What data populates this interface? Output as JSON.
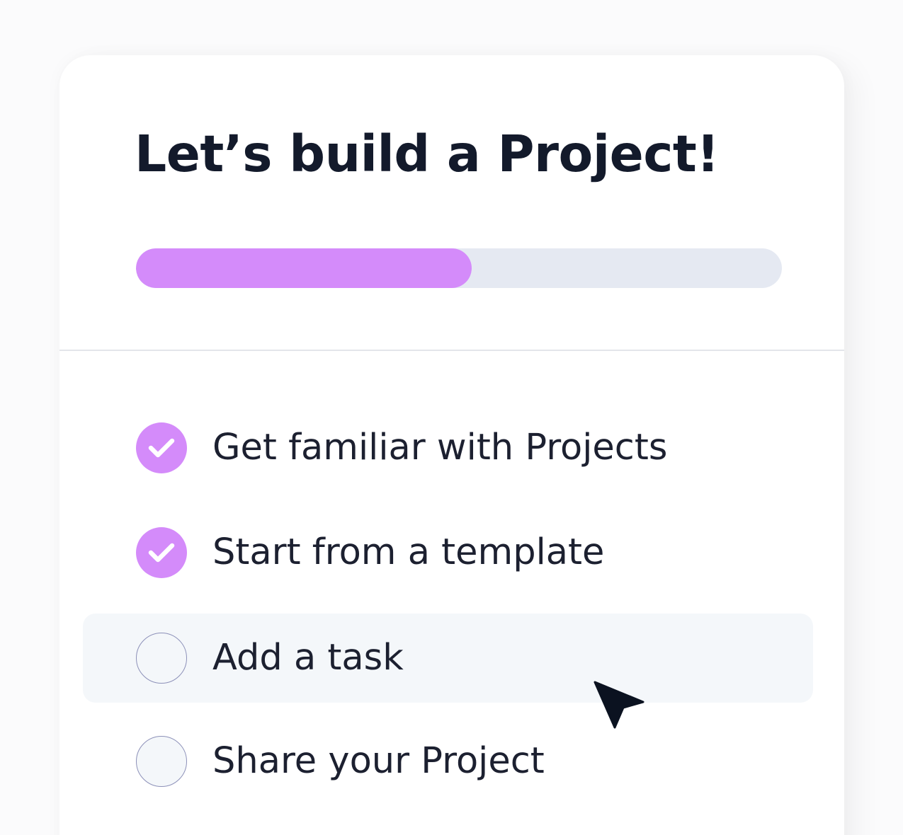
{
  "colors": {
    "accent": "#d48bfa",
    "track": "#e5e9f2",
    "title": "#131a2b",
    "text": "#1c2030",
    "hover_row": "#f4f7fa",
    "cursor": "#0b1220"
  },
  "header": {
    "title": "Let’s build a Project!"
  },
  "progress": {
    "fraction": 0.52
  },
  "tasks": [
    {
      "label": "Get familiar with Projects",
      "completed": true,
      "icon": "check-icon"
    },
    {
      "label": "Start from a template",
      "completed": true,
      "icon": "check-icon"
    },
    {
      "label": "Add a task",
      "completed": false,
      "hovered": true,
      "icon": "empty-circle-icon"
    },
    {
      "label": "Share your Project",
      "completed": false,
      "icon": "empty-circle-icon"
    }
  ],
  "cursor": {
    "icon": "mouse-pointer-icon"
  }
}
